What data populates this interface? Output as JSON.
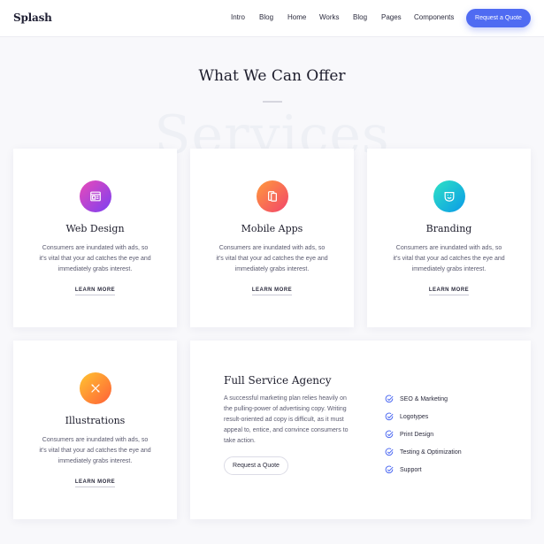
{
  "nav": {
    "brand": "Splash",
    "links": [
      "Intro",
      "Blog",
      "Home",
      "Works",
      "Blog",
      "Pages",
      "Components"
    ],
    "cta": "Request a Quote"
  },
  "header": {
    "title": "What We Can Offer",
    "watermark": "Services"
  },
  "services": [
    {
      "icon": "browser-icon",
      "title": "Web Design",
      "desc": "Consumers are inundated with ads, so it's vital that your ad catches the eye and immediately grabs interest.",
      "link": "LEARN MORE"
    },
    {
      "icon": "mobile-icon",
      "title": "Mobile Apps",
      "desc": "Consumers are inundated with ads, so it's vital that your ad catches the eye and immediately grabs interest.",
      "link": "LEARN MORE"
    },
    {
      "icon": "smiley-icon",
      "title": "Branding",
      "desc": "Consumers are inundated with ads, so it's vital that your ad catches the eye and immediately grabs interest.",
      "link": "LEARN MORE"
    },
    {
      "icon": "pencil-ruler-icon",
      "title": "Illustrations",
      "desc": "Consumers are inundated with ads, so it's vital that your ad catches the eye and immediately grabs interest.",
      "link": "LEARN MORE"
    }
  ],
  "agency": {
    "title": "Full Service Agency",
    "desc": "A successful marketing plan relies heavily on the pulling-power of advertising copy. Writing result-oriented ad copy is difficult, as it must appeal to, entice, and convince consumers to take action.",
    "button": "Request a Quote",
    "features": [
      "SEO & Marketing",
      "Logotypes",
      "Print Design",
      "Testing & Optimization",
      "Support"
    ]
  },
  "colors": {
    "accent": "#4f6bf2",
    "check": "#4f6bf2"
  }
}
